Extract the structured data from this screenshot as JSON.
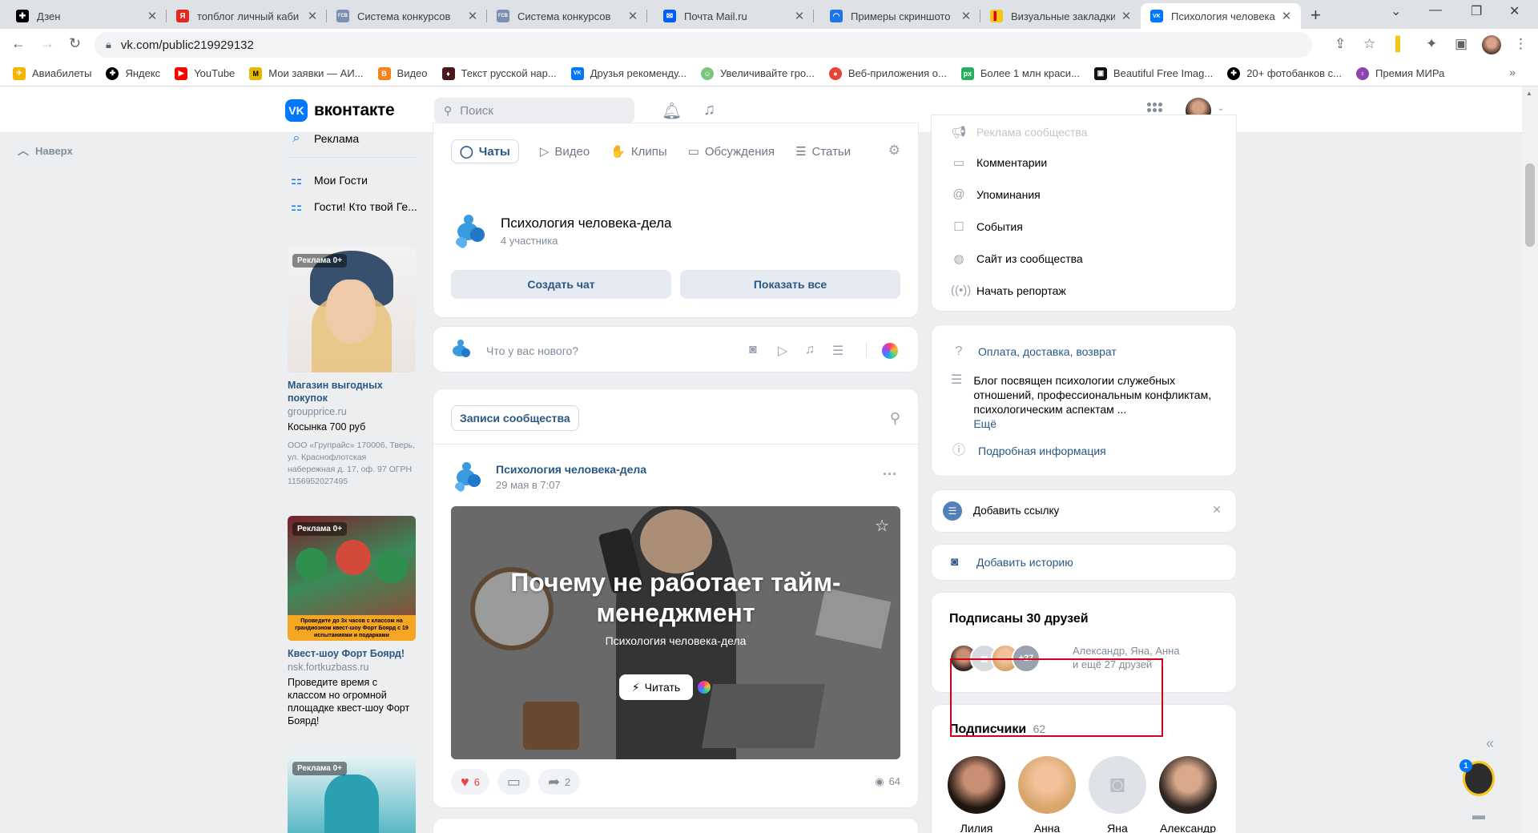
{
  "browser": {
    "tabs": [
      {
        "title": "Дзен",
        "fav_color": "#000000",
        "fav_glyph": "✚"
      },
      {
        "title": "топблог личный каби",
        "fav_color": "#e52620",
        "fav_glyph": "Я"
      },
      {
        "title": "Система конкурсов",
        "fav_color": "#7b8fb0",
        "fav_glyph": "ГСВ"
      },
      {
        "title": "Система конкурсов",
        "fav_color": "#7b8fb0",
        "fav_glyph": "ГСВ"
      },
      {
        "title": "Почта Mail.ru",
        "fav_color": "#005ff9",
        "fav_glyph": "✉"
      },
      {
        "title": "Примеры скриншото",
        "fav_color": "#1a73e8",
        "fav_glyph": "◠"
      },
      {
        "title": "Визуальные закладки",
        "fav_color": "#f5c518",
        "fav_glyph": "▌"
      },
      {
        "title": "Психология человека",
        "fav_color": "#0077ff",
        "fav_glyph": "VK"
      }
    ],
    "new_tab": "+",
    "url": "vk.com/public219929132",
    "bookmarks": [
      {
        "label": "Авиабилеты",
        "color": "#f5b400",
        "glyph": "✈"
      },
      {
        "label": "Яндекс",
        "color": "#000000",
        "glyph": "✚"
      },
      {
        "label": "YouTube",
        "color": "#ff0000",
        "glyph": "▶"
      },
      {
        "label": "Мои заявки — АИ...",
        "color": "#e6b800",
        "glyph": "M"
      },
      {
        "label": "Видео",
        "color": "#f5821f",
        "glyph": "В"
      },
      {
        "label": "Текст русской нар...",
        "color": "#4a1a1a",
        "glyph": "♦"
      },
      {
        "label": "Друзья рекоменду...",
        "color": "#0077ff",
        "glyph": "VK"
      },
      {
        "label": "Увеличивайте гро...",
        "color": "#7bc67e",
        "glyph": "☺"
      },
      {
        "label": "Веб-приложения о...",
        "color": "#ea4335",
        "glyph": "●"
      },
      {
        "label": "Более 1 млн краси...",
        "color": "#27ae60",
        "glyph": "px"
      },
      {
        "label": "Beautiful Free Imag...",
        "color": "#111111",
        "glyph": "▣"
      },
      {
        "label": "20+ фотобанков с...",
        "color": "#000000",
        "glyph": "✚"
      },
      {
        "label": "Премия МИРа",
        "color": "#8e44ad",
        "glyph": "♀"
      }
    ]
  },
  "vk": {
    "logo_text": "вконтакте",
    "search_placeholder": "Поиск",
    "back_to_top": "Наверх",
    "left_menu": [
      "Реклама",
      "Мои Гости",
      "Гости! Кто твой Ге..."
    ],
    "ads": [
      {
        "tag": "Реклама 0+",
        "title": "Магазин выгодных покупок",
        "domain": "groupprice.ru",
        "text": "Косынка 700 руб",
        "legal": "ООО «Групрайс» 170006, Тверь, ул. Краснофлотская набережная д. 17, оф. 97 ОГРН 1156952027495"
      },
      {
        "tag": "Реклама 0+",
        "title": "Квест-шоу Форт Боярд!",
        "domain": "nsk.fortkuzbass.ru",
        "text": "Проведите время с классом но огромной площадке квест-шоу Форт Боярд!",
        "img_caption": "Проведите до 3х часов с классом на грандиозном квест-шоу Форт Боярд с 19 испытаниями и подарками"
      },
      {
        "tag": "Реклама 0+"
      }
    ],
    "content_tabs": [
      "Чаты",
      "Видео",
      "Клипы",
      "Обсуждения",
      "Статьи"
    ],
    "chat": {
      "name": "Психология человека-дела",
      "members": "4 участника"
    },
    "create_chat": "Создать чат",
    "show_all": "Показать все",
    "compose_placeholder": "Что у вас нового?",
    "wall_tab": "Записи сообщества",
    "post": {
      "author": "Психология человека-дела",
      "date": "29 мая в 7:07",
      "article_title": "Почему не работает тайм-менеджмент",
      "article_sub": "Психология человека-дела",
      "read_label": "Читать",
      "likes": "6",
      "reposts": "2",
      "views": "64"
    },
    "right_menu": [
      {
        "label": "Реклама сообщества",
        "icon": "megaphone-icon"
      },
      {
        "label": "Комментарии",
        "icon": "comment-icon"
      },
      {
        "label": "Упоминания",
        "icon": "at-icon"
      },
      {
        "label": "События",
        "icon": "event-icon"
      },
      {
        "label": "Сайт из сообщества",
        "icon": "globe-icon"
      },
      {
        "label": "Начать репортаж",
        "icon": "broadcast-icon"
      }
    ],
    "info": {
      "payment_link": "Оплата, доставка, возврат",
      "description": "Блог посвящен психологии служебных отношений, профессиональным конфликтам, психологическим аспектам ...",
      "more": "Ещё",
      "details_link": "Подробная информация"
    },
    "add_link": "Добавить ссылку",
    "add_story": "Добавить историю",
    "friends": {
      "title": "Подписаны 30 друзей",
      "names": "Александр, Яна, Анна",
      "more": "и ещё 27 друзей",
      "badge": "+27"
    },
    "followers": {
      "title": "Подписчики",
      "count": "62",
      "people": [
        "Лилия",
        "Анна",
        "Яна",
        "Александр"
      ]
    },
    "notify_badge": "1"
  }
}
